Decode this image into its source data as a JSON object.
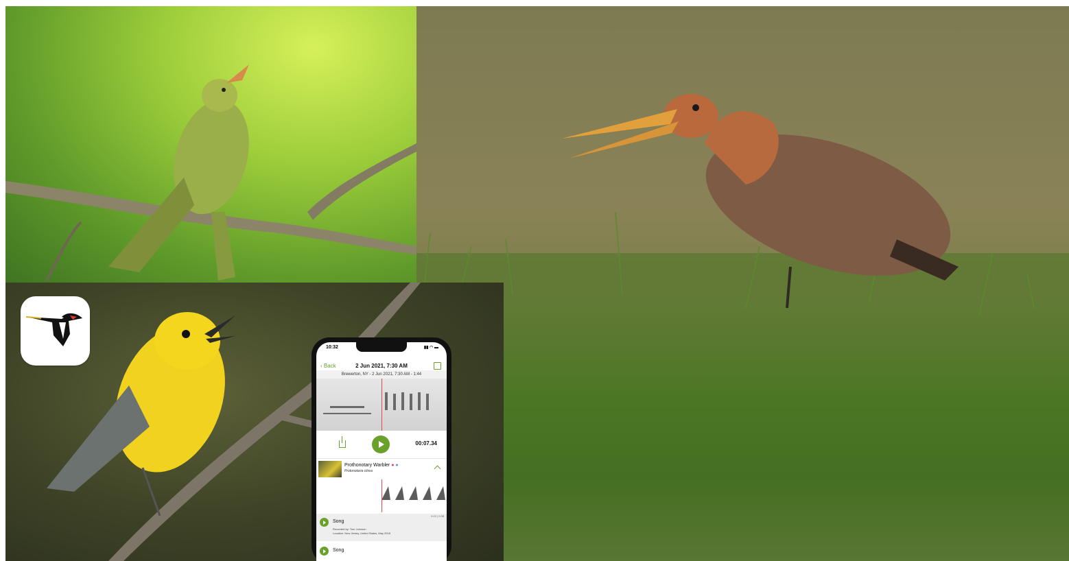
{
  "app": {
    "icon": "merlin-bird-app-icon"
  },
  "phone": {
    "status_time": "10:32",
    "status_icons": "▮▮ ◠ ▬",
    "back_label": "Back",
    "nav_title": "2 Jun 2021, 7:30 AM",
    "edit_icon": "edit-icon",
    "subhead": "Brewerton, NY - 2 Jun 2021, 7:30 AM - 1:44",
    "timer": "00:07.34",
    "species_name": "Prothonotary Warbler",
    "species_scientific": "Protonotaria citrea",
    "songs": [
      {
        "label": "Song",
        "recorded_by": "Recorded by: Tom Johnson",
        "location": "Location: New Jersey, United States, May 2018",
        "duration": "0:02 | 0:38"
      },
      {
        "label": "Song"
      }
    ]
  },
  "colors": {
    "accent": "#6aa12b",
    "playhead": "#e04a4a"
  }
}
